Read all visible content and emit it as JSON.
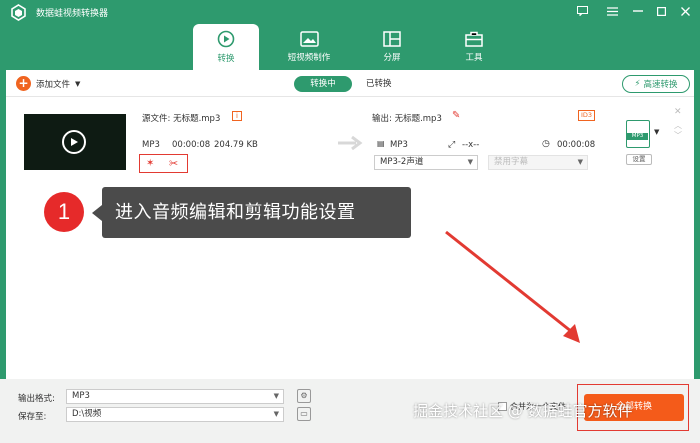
{
  "app": {
    "title": "数据蛙视频转换器"
  },
  "tabs": [
    {
      "label": "转换",
      "active": true
    },
    {
      "label": "短视频制作",
      "active": false
    },
    {
      "label": "分屏",
      "active": false
    },
    {
      "label": "工具",
      "active": false
    }
  ],
  "toolbar": {
    "add_file_label": "添加文件",
    "converting_label": "转换中",
    "converted_label": "已转换",
    "fast_convert_label": "高速转换"
  },
  "file": {
    "source_label": "源文件: 无标题.mp3",
    "format": "MP3",
    "duration": "00:00:08",
    "size": "204.79 KB",
    "output_label": "输出: 无标题.mp3",
    "output_format": "MP3",
    "resolution": "--x--",
    "output_duration": "00:00:08",
    "audio_select": "MP3-2声道",
    "subtitle_select": "禁用字幕",
    "id3_badge": "ID3",
    "format_badge": "MP3",
    "settings_label": "设置"
  },
  "callout": {
    "number": "1",
    "text": "进入音频编辑和剪辑功能设置"
  },
  "bottom": {
    "output_format_label": "输出格式:",
    "output_format_value": "MP3",
    "save_to_label": "保存至:",
    "save_to_value": "D:\\视频",
    "merge_label": "合并为一个文件",
    "convert_all_label": "全部转换"
  },
  "watermark": "掘金技术社区 @ 数据蛙官方软件",
  "colors": {
    "brand": "#2e9a6e",
    "accent": "#f45b1a",
    "highlight": "#e23a32"
  }
}
